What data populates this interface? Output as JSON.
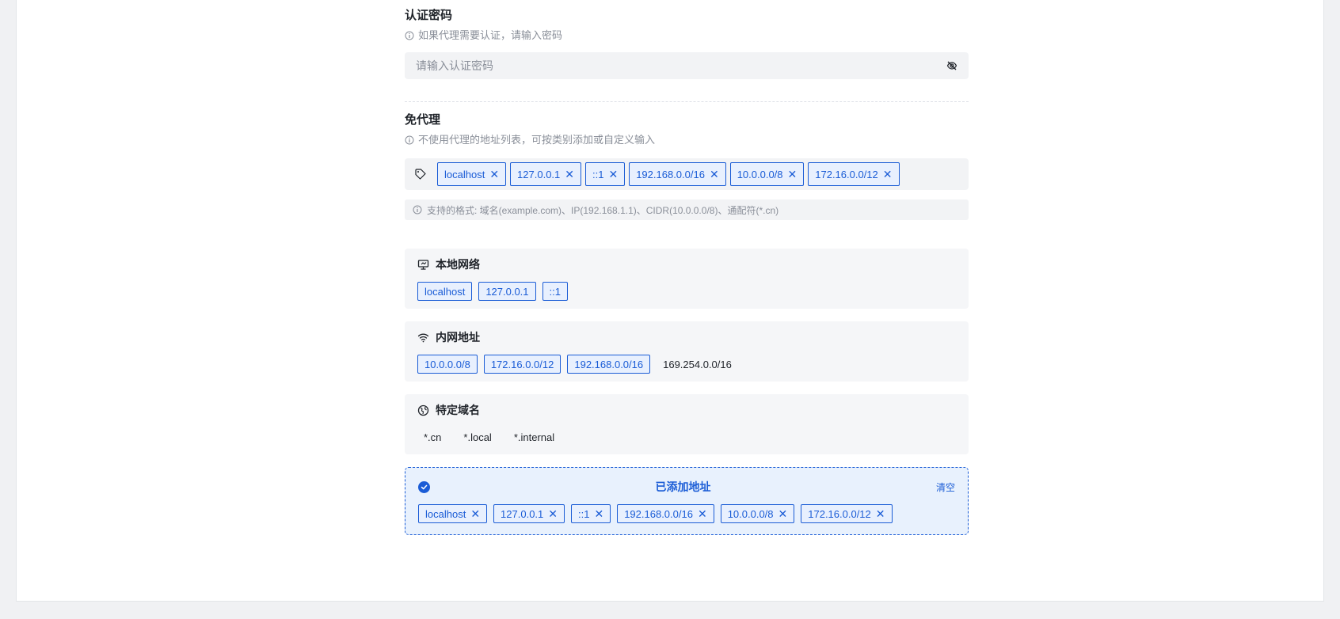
{
  "auth_password": {
    "label": "认证密码",
    "hint": "如果代理需要认证，请输入密码",
    "placeholder": "请输入认证密码",
    "value": ""
  },
  "no_proxy": {
    "label": "免代理",
    "hint": "不使用代理的地址列表，可按类别添加或自定义输入",
    "tags": [
      "localhost",
      "127.0.0.1",
      "::1",
      "192.168.0.0/16",
      "10.0.0.0/8",
      "172.16.0.0/12"
    ],
    "format_hint": "支持的格式: 域名(example.com)、IP(192.168.1.1)、CIDR(10.0.0.0/8)、通配符(*.cn)"
  },
  "groups": {
    "local": {
      "title": "本地网络",
      "items": [
        "localhost",
        "127.0.0.1",
        "::1"
      ]
    },
    "intranet": {
      "title": "内网地址",
      "selected": [
        "10.0.0.0/8",
        "172.16.0.0/12",
        "192.168.0.0/16"
      ],
      "unselected": [
        "169.254.0.0/16"
      ]
    },
    "domains": {
      "title": "特定域名",
      "items": [
        "*.cn",
        "*.local",
        "*.internal"
      ]
    }
  },
  "added": {
    "title": "已添加地址",
    "clear_label": "清空",
    "tags": [
      "localhost",
      "127.0.0.1",
      "::1",
      "192.168.0.0/16",
      "10.0.0.0/8",
      "172.16.0.0/12"
    ]
  },
  "colors": {
    "accent": "#1a5cd6",
    "tag_bg": "#e8f0fe",
    "muted": "#8a8f99"
  }
}
